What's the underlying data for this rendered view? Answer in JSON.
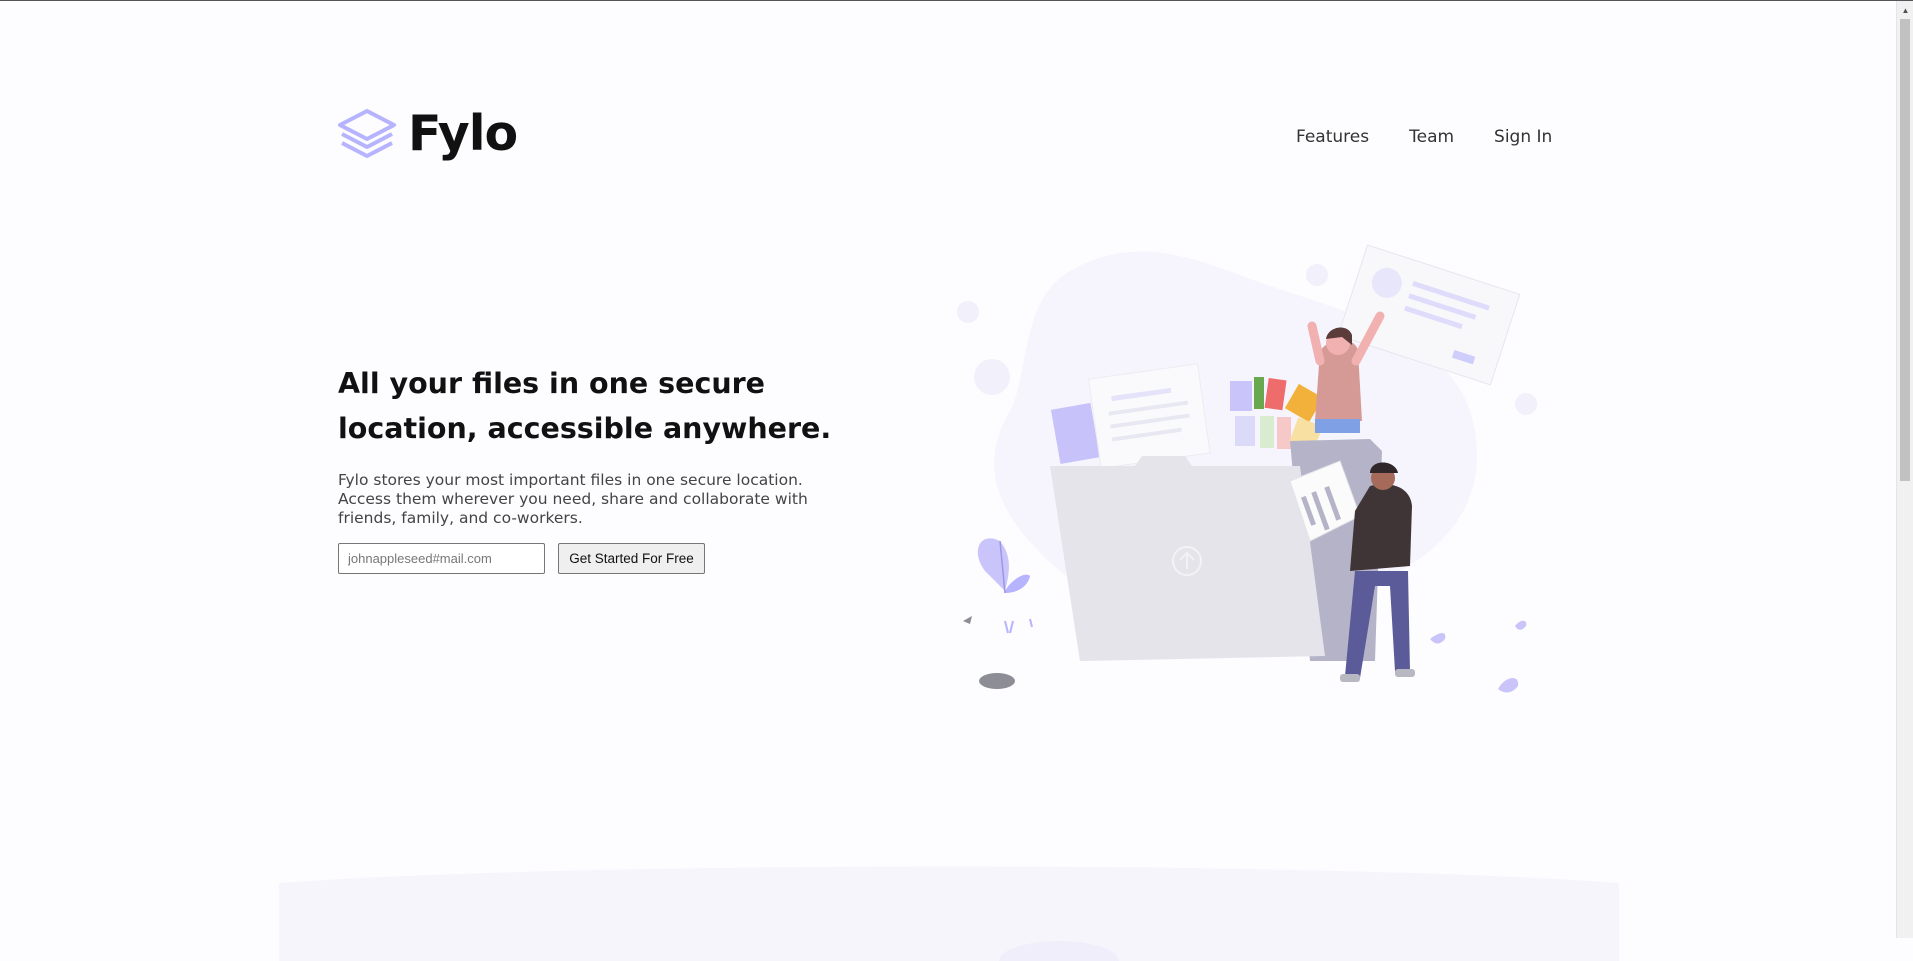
{
  "brand": {
    "name": "Fylo",
    "accent": "#b6b3ff"
  },
  "nav": {
    "items": [
      "Features",
      "Team",
      "Sign In"
    ]
  },
  "hero": {
    "headline": "All your files in one secure location, accessible anywhere.",
    "description": "Fylo stores your most important files in one secure location. Access them wherever you need, share and collaborate with friends, family, and co-workers.",
    "email_placeholder": "johnappleseed#mail.com",
    "cta_label": "Get Started For Free",
    "illustration": "illustration-intro"
  },
  "colors": {
    "background": "#fdfcfe",
    "band": "#f6f5fc",
    "text": "#111111"
  }
}
